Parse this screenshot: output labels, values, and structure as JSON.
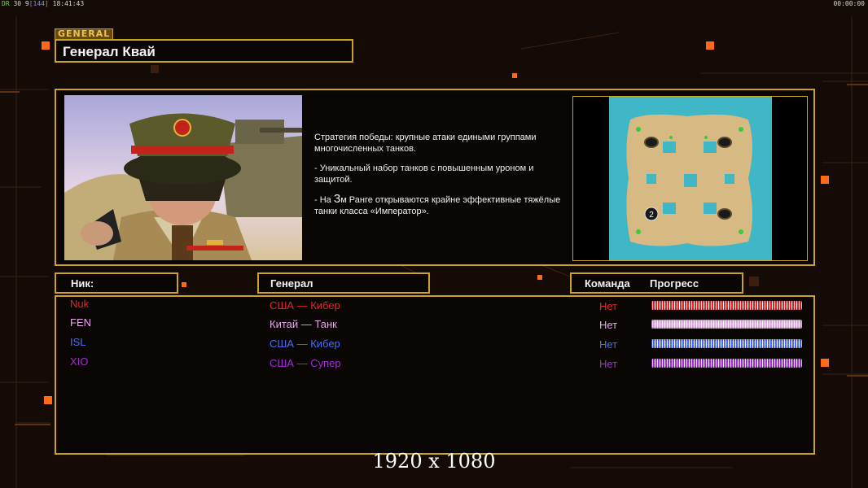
{
  "hud": {
    "fps_label": "DR",
    "stats": "30 9",
    "stats_bracket": "[144]",
    "clock_left": "18:41:43",
    "clock_right": "00:00:00"
  },
  "header": {
    "tag": "GENERAL",
    "title": "Генерал Квай"
  },
  "strategy": {
    "line1": "Стратегия победы: крупные атаки едиными группами многочисленных танков.",
    "line2": "- Уникальный набор танков с повышенным уроном и защитой.",
    "line3_pre": "- На",
    "line3_num": "3",
    "line3_post": "м Ранге открываются крайне эффективные тяжёлые танки класса «Император»."
  },
  "map": {
    "marker": "2"
  },
  "columns": {
    "nick": "Ник:",
    "general": "Генерал",
    "team": "Команда",
    "progress": "Прогресс"
  },
  "players": [
    {
      "nick": "Nuk",
      "general": "США — Кибер",
      "team": "Нет",
      "color": "#e0282b",
      "progress": 1.0
    },
    {
      "nick": "FEN",
      "general": "Китай — Танк",
      "team": "Нет",
      "color": "#e7a8ec",
      "progress": 1.0
    },
    {
      "nick": "ISL",
      "general": "США — Кибер",
      "team": "Нет",
      "color": "#4f6cf0",
      "progress": 1.0
    },
    {
      "nick": "XIO",
      "general": "США — Супер",
      "team": "Нет",
      "color": "#a12fd6",
      "progress": 1.0
    }
  ],
  "footer": {
    "resolution": "1920 x 1080"
  },
  "colors": {
    "frame": "#c9a227",
    "background": "#140b07",
    "accent_square": "#ff6a1a"
  }
}
